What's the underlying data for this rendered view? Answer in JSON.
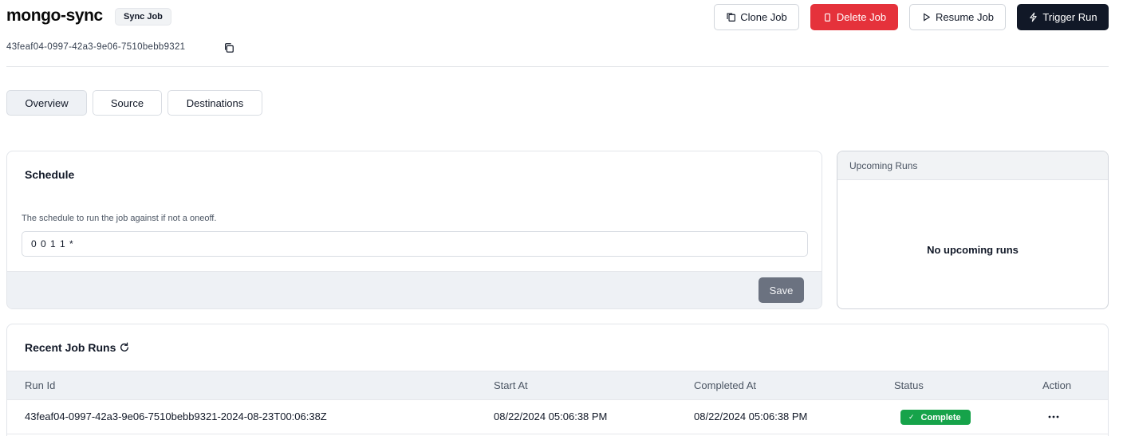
{
  "header": {
    "title": "mongo-sync",
    "badge": "Sync Job",
    "job_id": "43feaf04-0997-42a3-9e06-7510bebb9321"
  },
  "actions": {
    "clone": "Clone Job",
    "delete": "Delete Job",
    "resume": "Resume Job",
    "trigger": "Trigger Run"
  },
  "tabs": [
    {
      "label": "Overview",
      "active": true
    },
    {
      "label": "Source",
      "active": false
    },
    {
      "label": "Destinations",
      "active": false
    }
  ],
  "schedule": {
    "title": "Schedule",
    "description": "The schedule to run the job against if not a oneoff.",
    "value": "0 0 1 1 *",
    "save_label": "Save"
  },
  "upcoming": {
    "title": "Upcoming Runs",
    "empty_text": "No upcoming runs"
  },
  "recent_runs": {
    "title": "Recent Job Runs",
    "columns": [
      "Run Id",
      "Start At",
      "Completed At",
      "Status",
      "Action"
    ],
    "rows": [
      {
        "run_id": "43feaf04-0997-42a3-9e06-7510bebb9321-2024-08-23T00:06:38Z",
        "start_at": "08/22/2024 05:06:38 PM",
        "completed_at": "08/22/2024 05:06:38 PM",
        "status": "Complete"
      }
    ]
  },
  "colors": {
    "danger": "#e5323b",
    "dark": "#111827",
    "success": "#16a34a",
    "muted_button": "#6b7280"
  }
}
